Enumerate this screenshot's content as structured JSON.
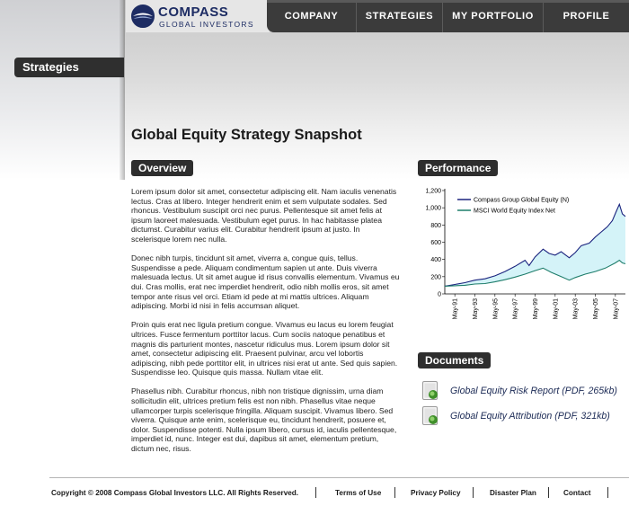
{
  "brand": {
    "name": "COMPASS",
    "subtitle": "GLOBAL INVESTORS",
    "colors": {
      "navy": "#1d2c63",
      "nav_bg": "#3b3b3b",
      "pill_bg": "#2e2e2e",
      "link": "#1b2a55"
    }
  },
  "nav": {
    "items": [
      "COMPANY",
      "STRATEGIES",
      "MY PORTFOLIO",
      "PROFILE"
    ]
  },
  "sidebar": {
    "section_label": "Strategies"
  },
  "page": {
    "title": "Global Equity Strategy Snapshot"
  },
  "overview": {
    "heading": "Overview",
    "paragraphs": [
      "Lorem ipsum dolor sit amet, consectetur adipiscing elit. Nam iaculis venenatis lectus. Cras at libero. Integer hendrerit enim et sem vulputate sodales. Sed rhoncus. Vestibulum suscipit orci nec purus. Pellentesque sit amet felis at ipsum laoreet malesuada. Vestibulum eget purus. In hac habitasse platea dictumst. Curabitur varius elit. Curabitur hendrerit ipsum at justo. In scelerisque lorem nec nulla.",
      "Donec nibh turpis, tincidunt sit amet, viverra a, congue quis, tellus. Suspendisse a pede. Aliquam condimentum sapien ut ante. Duis viverra malesuada lectus. Ut sit amet augue id risus convallis elementum. Vivamus eu dui. Cras mollis, erat nec imperdiet hendrerit, odio nibh mollis eros, sit amet tempor ante risus vel orci. Etiam id pede at mi mattis ultrices. Aliquam adipiscing. Morbi id nisi in felis accumsan aliquet.",
      "Proin quis erat nec ligula pretium congue. Vivamus eu lacus eu lorem feugiat ultrices. Fusce fermentum porttitor lacus. Cum sociis natoque penatibus et magnis dis parturient montes, nascetur ridiculus mus. Lorem ipsum dolor sit amet, consectetur adipiscing elit. Praesent pulvinar, arcu vel lobortis adipiscing, nibh pede porttitor elit, in ultrices nisi erat ut ante. Sed quis sapien. Suspendisse leo. Quisque quis massa. Nullam vitae elit.",
      "Phasellus nibh. Curabitur rhoncus, nibh non tristique dignissim, urna diam sollicitudin elit, ultrices pretium felis est non nibh. Phasellus vitae neque ullamcorper turpis scelerisque fringilla. Aliquam suscipit. Vivamus libero. Sed viverra. Quisque ante enim, scelerisque eu, tincidunt hendrerit, posuere et, dolor. Suspendisse potenti. Nulla ipsum libero, cursus id, iaculis pellentesque, imperdiet id, nunc. Integer est dui, dapibus sit amet, elementum pretium, dictum nec, risus."
    ]
  },
  "performance": {
    "heading": "Performance"
  },
  "chart_data": {
    "type": "area",
    "title": "",
    "xlabel": "",
    "ylabel": "",
    "ylim": [
      0,
      1200
    ],
    "yticks": [
      "0",
      "200",
      "400",
      "600",
      "800",
      "1,000",
      "1,200"
    ],
    "xticks": [
      "May-91",
      "May-93",
      "May-95",
      "May-97",
      "May-99",
      "May-01",
      "May-03",
      "May-05",
      "May-07"
    ],
    "grid": false,
    "legend": "top-left",
    "series": [
      {
        "name": "Compass Group Global Equity (N)",
        "color": "#1a237e",
        "x": [
          1990.4,
          1991.4,
          1992.4,
          1993.4,
          1994.4,
          1995.4,
          1996.4,
          1997.4,
          1998.4,
          1998.8,
          1999.4,
          2000.2,
          2000.8,
          2001.4,
          2002.0,
          2002.8,
          2003.4,
          2004.0,
          2004.8,
          2005.4,
          2006.0,
          2006.6,
          2007.1,
          2007.5,
          2007.8,
          2008.1,
          2008.4
        ],
        "values": [
          90,
          110,
          130,
          160,
          175,
          210,
          260,
          320,
          390,
          330,
          430,
          520,
          470,
          450,
          490,
          420,
          480,
          560,
          590,
          660,
          720,
          780,
          850,
          960,
          1040,
          930,
          900
        ]
      },
      {
        "name": "MSCI World Equity Index Net",
        "color": "#1e7d6b",
        "x": [
          1990.4,
          1991.4,
          1992.4,
          1993.4,
          1994.4,
          1995.4,
          1996.4,
          1997.4,
          1998.4,
          1999.4,
          2000.2,
          2001.0,
          2002.0,
          2002.8,
          2003.4,
          2004.4,
          2005.4,
          2006.4,
          2007.4,
          2007.8,
          2008.1,
          2008.4
        ],
        "values": [
          90,
          95,
          100,
          115,
          120,
          140,
          165,
          195,
          230,
          270,
          300,
          250,
          200,
          160,
          190,
          230,
          260,
          300,
          360,
          390,
          360,
          350
        ]
      }
    ]
  },
  "documents": {
    "heading": "Documents",
    "items": [
      {
        "label": "Global Equity Risk Report (PDF, 265kb)",
        "icon": "pdf-document-icon"
      },
      {
        "label": "Global Equity Attribution (PDF, 321kb)",
        "icon": "pdf-document-icon"
      }
    ]
  },
  "footer": {
    "copyright": "Copyright © 2008 Compass Global Investors LLC.  All Rights Reserved.",
    "links": [
      "Terms of Use",
      "Privacy Policy",
      "Disaster Plan",
      "Contact"
    ]
  }
}
